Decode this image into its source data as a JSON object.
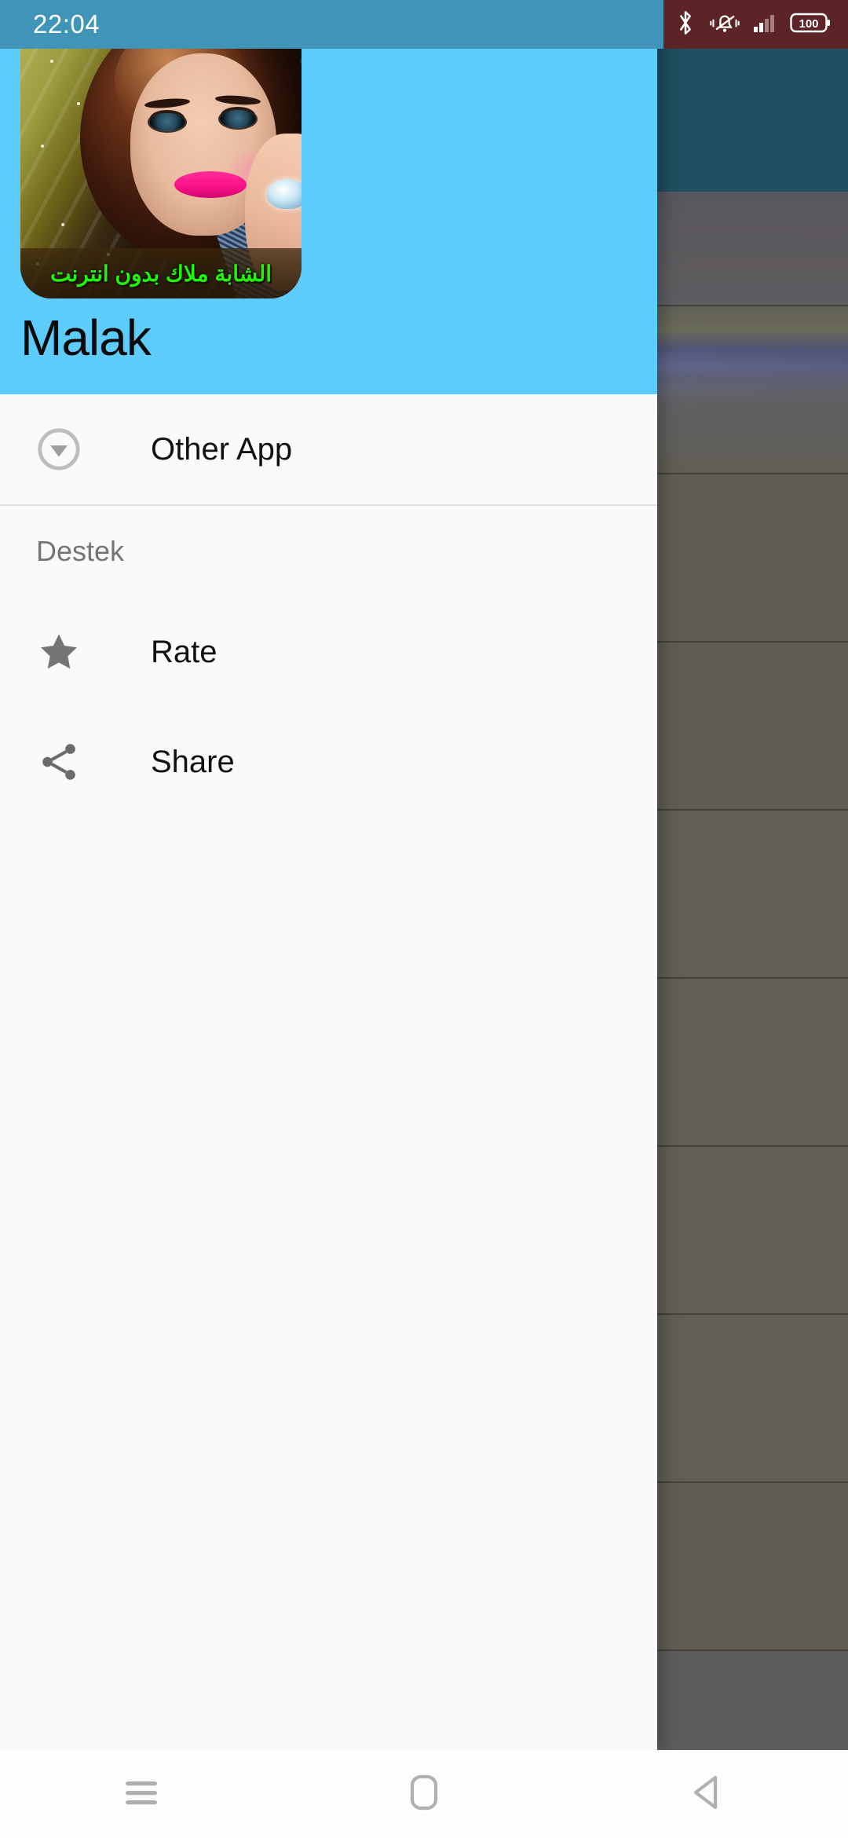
{
  "status_bar": {
    "time": "22:04",
    "left_bg_color": "#3f94b8",
    "right_bg_color": "#5d2427",
    "icons": [
      {
        "name": "bluetooth-icon",
        "label": "Bluetooth"
      },
      {
        "name": "vibrate-mute-icon",
        "label": "Ringer vibrate"
      },
      {
        "name": "signal-bars-icon",
        "label": "Cellular signal"
      },
      {
        "name": "battery-icon",
        "label": "Battery"
      }
    ],
    "battery_level": "100"
  },
  "drawer": {
    "header": {
      "app_title": "Malak",
      "icon_caption_ar": "الشابة ملاك بدون انترنت",
      "background_color": "#5ECCFB",
      "caption_color": "#21f508",
      "title_color": "#0b0b0b"
    },
    "items": [
      {
        "id": "other-app",
        "label": "Other App",
        "icon": "download-circle-icon"
      }
    ],
    "sections": [
      {
        "title": "Destek",
        "items": [
          {
            "id": "rate",
            "label": "Rate",
            "icon": "star-icon"
          },
          {
            "id": "share",
            "label": "Share",
            "icon": "share-icon"
          }
        ]
      }
    ]
  },
  "nav_bar": {
    "buttons": [
      {
        "id": "recents",
        "label": "Recents",
        "icon": "menu-lines-icon"
      },
      {
        "id": "home",
        "label": "Home",
        "icon": "home-rounded-square-icon"
      },
      {
        "id": "back",
        "label": "Back",
        "icon": "back-triangle-icon"
      }
    ]
  },
  "background_app": {
    "appbar_color": "#245a6e",
    "list_color": "#6d6a68",
    "row_count": 9
  }
}
